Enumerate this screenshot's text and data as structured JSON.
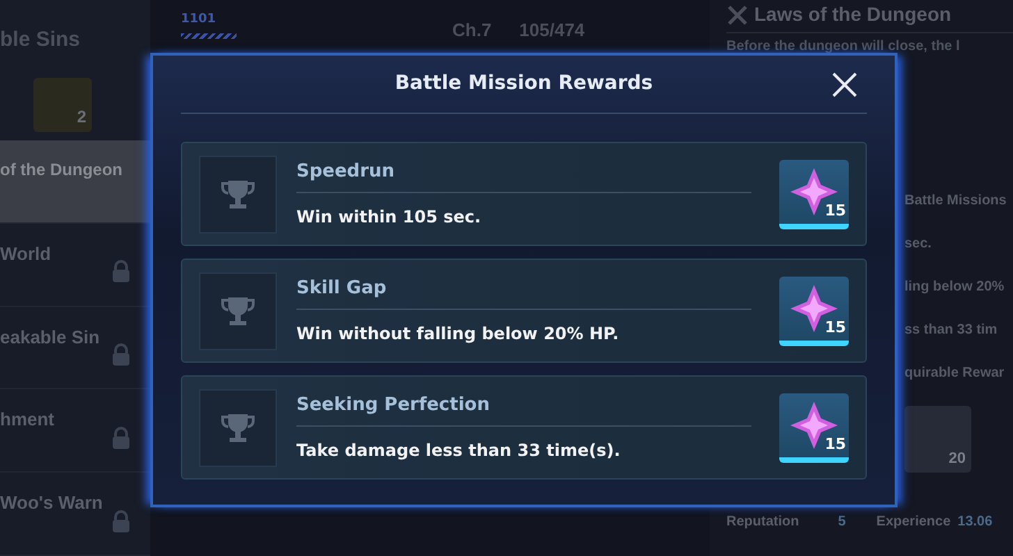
{
  "top_bar": {
    "code": "1101",
    "chapter": "Ch.7",
    "trophies": "105/474"
  },
  "sidebar": {
    "header": "ble Sins",
    "badge_count": "2",
    "items": [
      {
        "label": "of the Dungeon",
        "selected": true,
        "locked": false
      },
      {
        "label": "World",
        "selected": false,
        "locked": true
      },
      {
        "label": "eakable Sin",
        "selected": false,
        "locked": true
      },
      {
        "label": "hment",
        "selected": false,
        "locked": true
      },
      {
        "label": "Woo's Warn",
        "selected": false,
        "locked": true
      }
    ]
  },
  "info_panel": {
    "title": "Laws of the Dungeon",
    "description": "Before the dungeon will close, the l",
    "missions_heading": "Battle Missions",
    "mission_lines": [
      "sec.",
      "ling below 20%",
      "ss than 33 tim"
    ],
    "rewards_heading": "quirable Rewar",
    "reward_count": "20",
    "reputation_label": "Reputation",
    "reputation_value": "5",
    "experience_label": "Experience",
    "experience_value": "13.06"
  },
  "dialog": {
    "title": "Battle Mission Rewards",
    "missions": [
      {
        "name": "Speedrun",
        "description": "Win within 105 sec.",
        "reward_count": "15"
      },
      {
        "name": "Skill Gap",
        "description": "Win without falling below 20% HP.",
        "reward_count": "15"
      },
      {
        "name": "Seeking Perfection",
        "description": "Take damage less than 33 time(s).",
        "reward_count": "15"
      }
    ]
  }
}
